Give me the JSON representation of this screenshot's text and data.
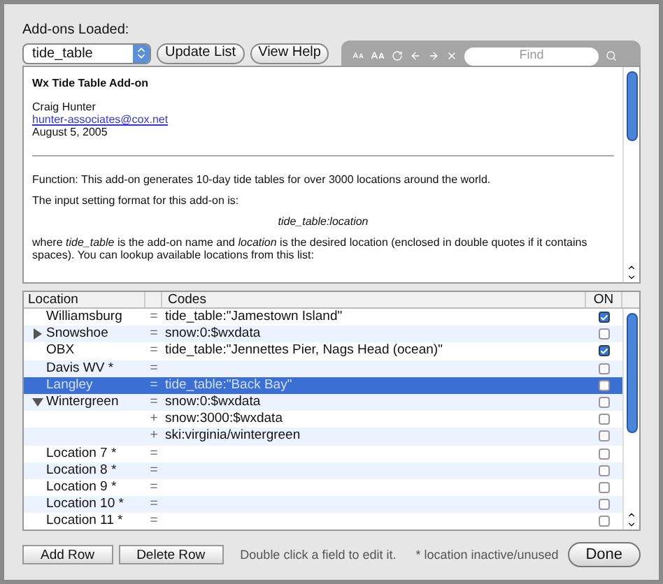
{
  "addons": {
    "label": "Add-ons Loaded:",
    "selected_addon": "tide_table",
    "buttons": [
      "Update List",
      "View Help"
    ]
  },
  "help_toolbar": {
    "find_placeholder": "Find"
  },
  "document": {
    "title": "Wx Tide Table Add-on",
    "author": "Craig Hunter",
    "email": "hunter-associates@cox.net",
    "date": "August 5, 2005",
    "paragraphs": [
      {
        "kind": "text",
        "text": "Function: This add-on generates 10-day tide tables for over 3000 locations around the world."
      },
      {
        "kind": "text",
        "text": "The input setting format for this add-on is:"
      },
      {
        "kind": "center",
        "text": "*tide_table:location*"
      },
      {
        "kind": "text",
        "text": "where *tide_table* is the add-on name and *location* is the desired location (enclosed in double quotes if it contains spaces). You can lookup available locations from this list:"
      }
    ]
  },
  "table": {
    "columns": [
      "Location",
      "Codes",
      "ON"
    ],
    "rows": [
      {
        "kind": "plain",
        "location": "Williamsburg",
        "op": "=",
        "code": "tide_table:\"Jamestown Island\"",
        "on": true,
        "selected": false
      },
      {
        "kind": "collapsed",
        "location": "Snowshoe",
        "op": "=",
        "code": "snow:0:$wxdata",
        "on": false,
        "selected": false
      },
      {
        "kind": "plain",
        "location": "OBX",
        "op": "=",
        "code": "tide_table:\"Jennettes Pier, Nags Head (ocean)\"",
        "on": true,
        "selected": false
      },
      {
        "kind": "plain",
        "location": "Davis WV *",
        "op": "=",
        "on": false,
        "selected": false
      },
      {
        "kind": "plain",
        "location": "Langley",
        "op": "=",
        "code": "tide_table:\"Back Bay\"",
        "on": false,
        "selected": true
      },
      {
        "kind": "expanded",
        "location": "Wintergreen",
        "op": "=",
        "code": "snow:0:$wxdata",
        "on": false,
        "selected": false
      },
      {
        "kind": "plain",
        "op": "+",
        "code": "snow:3000:$wxdata",
        "on": false,
        "selected": false
      },
      {
        "kind": "plain",
        "op": "+",
        "code": "ski:virginia/wintergreen",
        "on": false,
        "selected": false
      },
      {
        "kind": "plain",
        "location": "Location 7 *",
        "op": "=",
        "on": false,
        "selected": false
      },
      {
        "kind": "plain",
        "location": "Location 8 *",
        "op": "=",
        "on": false,
        "selected": false
      },
      {
        "kind": "plain",
        "location": "Location 9 *",
        "op": "=",
        "on": false,
        "selected": false
      },
      {
        "kind": "plain",
        "location": "Location 10 *",
        "op": "=",
        "on": false,
        "selected": false
      },
      {
        "kind": "plain",
        "location": "Location 11 *",
        "op": "=",
        "on": false,
        "selected": false
      }
    ]
  },
  "footer": {
    "buttons": [
      "Add Row",
      "Delete Row"
    ],
    "hint": "Double click a field to edit it.",
    "note": "* location inactive/unused",
    "done": "Done"
  }
}
